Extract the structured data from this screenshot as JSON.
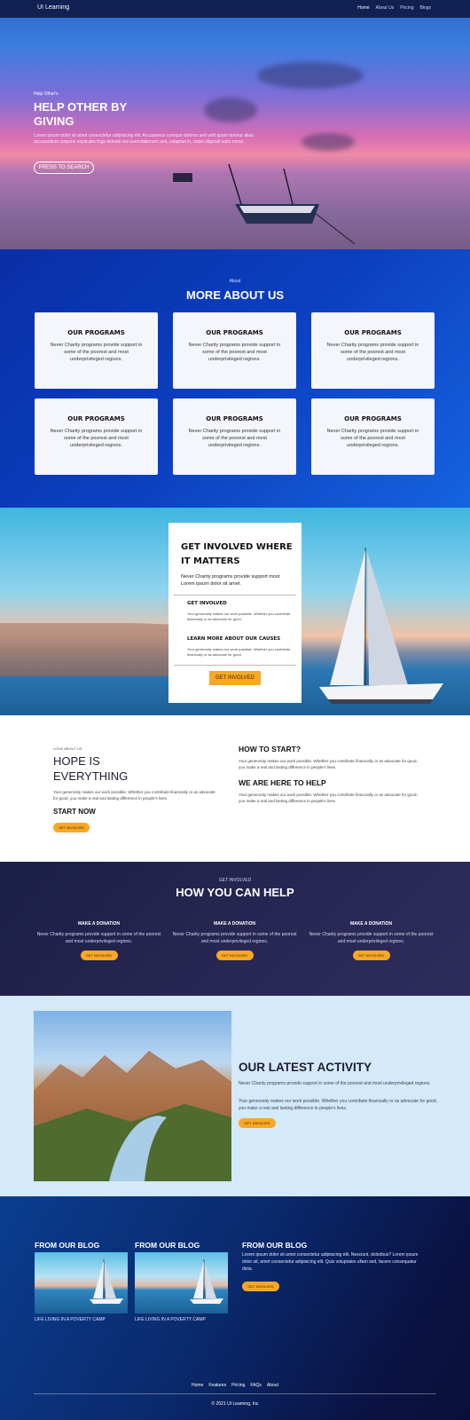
{
  "nav": {
    "brand": "UI Learning",
    "links": [
      "Home",
      "About Us",
      "Pricing",
      "Blogs"
    ]
  },
  "hero": {
    "eyebrow": "Help Other's",
    "title": "HELP OTHER BY GIVING",
    "description": "Lorem ipsum dolor sit amet consectetur adipisicing elit. Accusamus cumque dolores sed velit quam tenetur alias, accusantium corporis explicabo fuga deleniti nisi exercitationem sed, voluptas in, nobis eligendi iusto nemo.",
    "button": "PRESS TO SEARCH"
  },
  "about": {
    "eyebrow": "About",
    "title": "MORE ABOUT US",
    "cards": [
      {
        "title": "OUR PROGRAMS",
        "text": "Never Charity programs provide support in some of the poorest and most underprivileged regions."
      },
      {
        "title": "OUR PROGRAMS",
        "text": "Never Charity programs provide support in some of the poorest and most underprivileged regions."
      },
      {
        "title": "OUR PROGRAMS",
        "text": "Never Charity programs provide support in some of the poorest and most underprivileged regions."
      },
      {
        "title": "OUR PROGRAMS",
        "text": "Never Charity programs provide support in some of the poorest and most underprivileged regions."
      },
      {
        "title": "OUR PROGRAMS",
        "text": "Never Charity programs provide support in some of the poorest and most underprivileged regions."
      },
      {
        "title": "OUR PROGRAMS",
        "text": "Never Charity programs provide support in some of the poorest and most underprivileged regions."
      }
    ]
  },
  "involved": {
    "title": "GET INVOLVED WHERE IT MATTERS",
    "lead": "Never Charity programs provide support most Lorem ipsum dolor sit amet.",
    "item1_title": "GET INVOLVED",
    "item1_text": "Your generosity makes our work possible. Whether you contribute financially or as advocate for good.",
    "item2_title": "LEARN MORE ABOUT OUR CAUSES",
    "item2_text": "Your generosity makes our work possible. Whether you contribute financially or as advocate for good.",
    "button": "GET INVOLVED"
  },
  "hope": {
    "eyebrow": "LOOK ABOUT US",
    "title": "HOPE IS EVERYTHING",
    "text": "Your generosity makes our work possible. Whether you contribute financially or as advocate for good, you make a real and lasting difference in people's lives.",
    "start": "START NOW",
    "button": "GET INVOLVED",
    "right1_title": "HOW TO START?",
    "right1_text": "Your generosity makes our work possible. Whether you contribute financially or as advocate for good, you make a real and lasting difference in people's lives.",
    "right2_title": "WE ARE HERE TO HELP",
    "right2_text": "Your generosity makes our work possible. Whether you contribute financially or as advocate for good, you make a real and lasting difference in people's lives."
  },
  "help": {
    "eyebrow": "GET INVOLVED",
    "title": "HOW YOU CAN HELP",
    "cols": [
      {
        "title": "MAKE A DONATION",
        "text": "Never Charity programs provide support in some of the poorest and most underprivileged regions.",
        "button": "GET INVOLVED"
      },
      {
        "title": "MAKE A DONATION",
        "text": "Never Charity programs provide support in some of the poorest and most underprivileged regions.",
        "button": "GET INVOLVED"
      },
      {
        "title": "MAKE A DONATION",
        "text": "Never Charity programs provide support in some of the poorest and most underprivileged regions.",
        "button": "GET INVOLVED"
      }
    ]
  },
  "activity": {
    "title": "OUR LATEST ACTIVITY",
    "text1": "Never Charity programs provide support in some of the poorest and most underprivileged regions.",
    "text2": "Your generosity makes our work possible. Whether you contribute financially or as advocate for good, you make a real and lasting difference in people's lives.",
    "button": "GET INVOLVED"
  },
  "blog": {
    "col1_title": "FROM OUR BLOG",
    "col1_caption": "LIFE LIVING IN A POVERTY CAMP",
    "col2_title": "FROM OUR BLOG",
    "col2_caption": "LIFE LIVING IN A POVERTY CAMP",
    "col3_title": "FROM OUR BLOG",
    "col3_text": "Lorem ipsum dolor sit amet consectetur adipisicing elit. Nesciunt, doloribus? Lorem ipsum dolor sit, amet consectetur adipisicing elit. Quis voluptates ullam sed, facere consequatur dicta.",
    "button": "GET INVOLVED"
  },
  "footer": {
    "links": [
      "Home",
      "Features",
      "Pricing",
      "FAQs",
      "About"
    ],
    "copyright": "© 2021 UI Learning, Inc"
  },
  "colors": {
    "accent": "#f9a825",
    "about_bg": "#0b3fc0",
    "help_bg": "#272652",
    "activity_bg": "#d4e9fa"
  }
}
